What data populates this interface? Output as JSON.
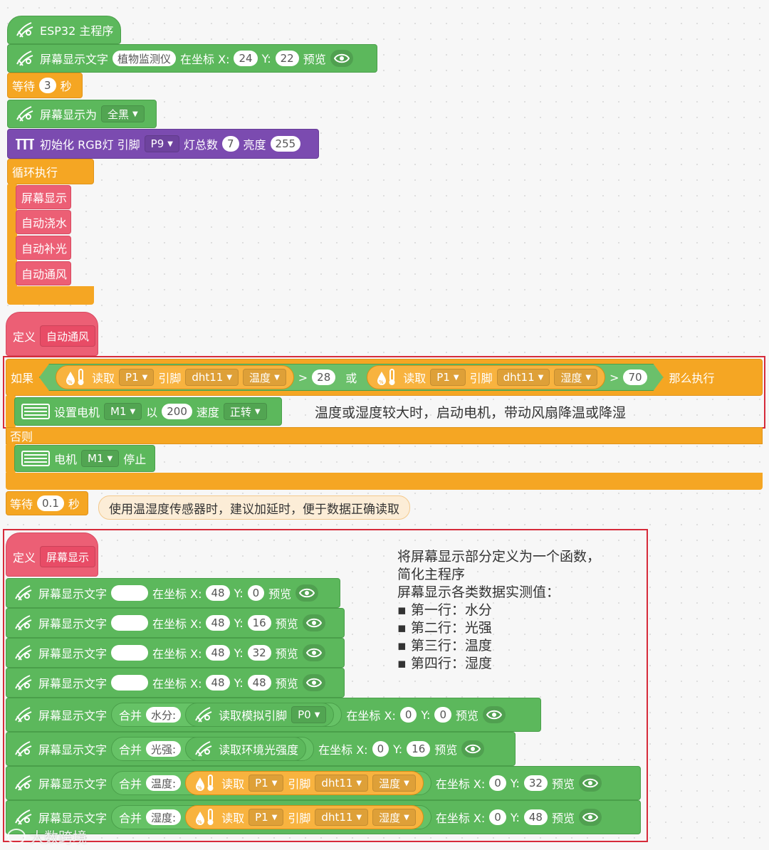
{
  "main_program": {
    "hat_label": "ESP32 主程序",
    "display_text": {
      "label": "屏幕显示文字",
      "text": "植物监测仪",
      "at_x": "在坐标 X:",
      "x": "24",
      "y_label": "Y:",
      "y": "22",
      "preview": "预览"
    },
    "wait": {
      "label": "等待",
      "value": "3",
      "unit": "秒"
    },
    "display_as": {
      "label": "屏幕显示为",
      "option": "全黑"
    },
    "rgb_init": {
      "label": "初始化 RGB灯 引脚",
      "pin": "P9",
      "count_label": "灯总数",
      "count": "7",
      "brightness_label": "亮度",
      "brightness": "255"
    },
    "loop": {
      "label": "循环执行",
      "calls": [
        "屏幕显示",
        "自动浇水",
        "自动补光",
        "自动通风"
      ]
    }
  },
  "auto_vent": {
    "define_label": "定义",
    "name": "自动通风",
    "if_label": "如果",
    "then_label": "那么执行",
    "or_label": "或",
    "read_label": "读取",
    "pin_label": "引脚",
    "cond1": {
      "pin": "P1",
      "sensor": "dht11",
      "measure": "温度",
      "op": ">",
      "value": "28"
    },
    "cond2": {
      "pin": "P1",
      "sensor": "dht11",
      "measure": "湿度",
      "op": ">",
      "value": "70"
    },
    "set_motor": {
      "label": "设置电机",
      "motor": "M1",
      "with_label": "以",
      "speed": "200",
      "speed_label": "速度",
      "direction": "正转"
    },
    "comment_then": "温度或湿度较大时，启动电机，带动风扇降温或降湿",
    "else_label": "否则",
    "stop_motor": {
      "label": "电机",
      "motor": "M1",
      "action": "停止"
    },
    "wait": {
      "label": "等待",
      "value": "0.1",
      "unit": "秒"
    },
    "wait_comment": "使用温湿度传感器时，建议加延时，便于数据正确读取"
  },
  "screen_display": {
    "define_label": "定义",
    "name": "屏幕显示",
    "note": {
      "line1": "将屏幕显示部分定义为一个函数，",
      "line2": "简化主程序",
      "line3": "屏幕显示各类数据实测值：",
      "bullets": [
        "第一行：水分",
        "第二行：光强",
        "第三行：温度",
        "第四行：湿度"
      ]
    },
    "common": {
      "label": "屏幕显示文字",
      "at_x": "在坐标 X:",
      "y_label": "Y:",
      "preview": "预览",
      "merge": "合并",
      "read": "读取",
      "pin": "引脚"
    },
    "rows": [
      {
        "x": "48",
        "y": "0"
      },
      {
        "x": "48",
        "y": "16"
      },
      {
        "x": "48",
        "y": "32"
      },
      {
        "x": "48",
        "y": "48"
      }
    ],
    "merged": [
      {
        "prefix": "水分:",
        "sensor_label": "读取模拟引脚",
        "pin": "P0",
        "x": "0",
        "y": "0"
      },
      {
        "prefix": "光强:",
        "sensor_label": "读取环境光强度",
        "x": "0",
        "y": "16"
      },
      {
        "prefix": "温度:",
        "pin": "P1",
        "sensor": "dht11",
        "measure": "温度",
        "x": "0",
        "y": "32"
      },
      {
        "prefix": "湿度:",
        "pin": "P1",
        "sensor": "dht11",
        "measure": "湿度",
        "x": "0",
        "y": "48"
      }
    ]
  },
  "watermark": "大数跨境",
  "colors": {
    "display": "#5cb85c",
    "control": "#f5a623",
    "rgb": "#7b4bb0",
    "function": "#ec5f75",
    "highlight": "#d62b3a"
  }
}
